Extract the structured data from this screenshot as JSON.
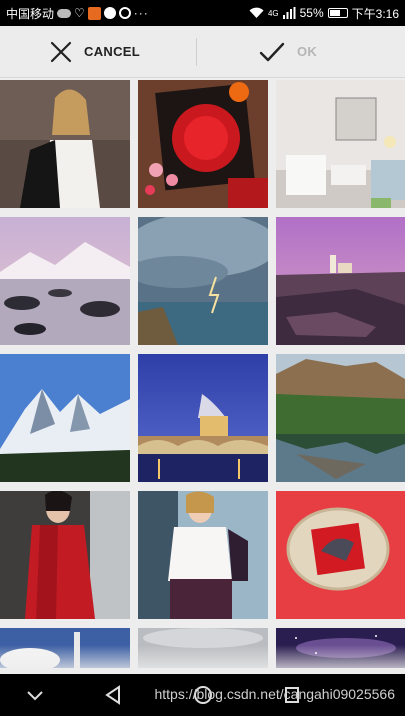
{
  "status_bar": {
    "carrier": "中国移动",
    "network": "4G",
    "battery": "55%",
    "time": "下午3:16",
    "dots": "···"
  },
  "action_bar": {
    "cancel_label": "CANCEL",
    "ok_label": "OK",
    "ok_enabled": false
  },
  "gallery": {
    "items": [
      {
        "subject": "woman in white dress with leather jacket"
      },
      {
        "subject": "red paper-cut decoration with plum blossoms"
      },
      {
        "subject": "bright living room interior"
      },
      {
        "subject": "misty lake with snowy mountains"
      },
      {
        "subject": "stormy sky with lightning over coast"
      },
      {
        "subject": "purple dusk over rocky coast with lighthouse"
      },
      {
        "subject": "snow-capped mountain peaks"
      },
      {
        "subject": "domed church and bridge at night"
      },
      {
        "subject": "mountain cliff reflected in lake"
      },
      {
        "subject": "woman in red coat"
      },
      {
        "subject": "woman in white blouse with purple skirt"
      },
      {
        "subject": "red paper cut in woven bowl"
      },
      {
        "subject": "rocket launch"
      },
      {
        "subject": "grey sky"
      },
      {
        "subject": "starry night sky"
      }
    ]
  },
  "nav_bar": {
    "watermark": "https://blog.csdn.net/cangahi09025566"
  },
  "colors": {
    "status_bar_bg": "#000000",
    "action_bar_bg": "#ececec",
    "ok_disabled": "#b5b5b5"
  }
}
